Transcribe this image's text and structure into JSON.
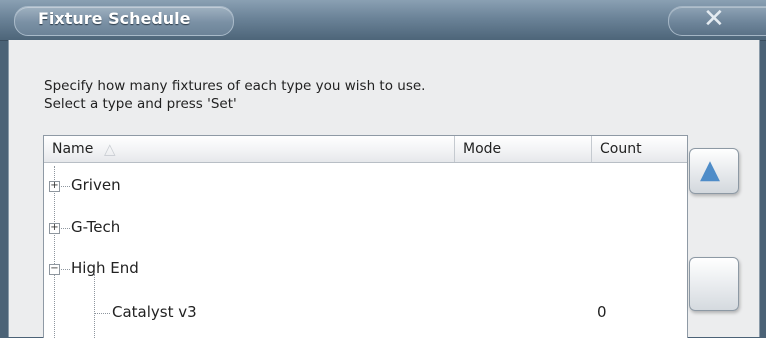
{
  "window": {
    "title": "Fixture Schedule",
    "close_icon": "close-icon"
  },
  "instructions": {
    "line1": "Specify how many fixtures of each type you wish to use.",
    "line2": "Select a type and press 'Set'"
  },
  "list": {
    "columns": {
      "name": "Name",
      "mode": "Mode",
      "count": "Count"
    },
    "sort_indicator": "sort-ascending-icon",
    "rows": [
      {
        "name": "Griven",
        "expander": "+",
        "mode": "",
        "count": ""
      },
      {
        "name": "G-Tech",
        "expander": "+",
        "mode": "",
        "count": ""
      },
      {
        "name": "High End",
        "expander": "−",
        "mode": "",
        "count": ""
      },
      {
        "name": "Catalyst v3",
        "expander": "",
        "mode": "",
        "count": "0"
      }
    ]
  },
  "scrollbar": {
    "up_icon": "scroll-up-icon"
  },
  "colors": {
    "titlebar": "#6b8398",
    "dialog_bg": "#ecedee",
    "accent_arrow": "#4e8cc8"
  }
}
